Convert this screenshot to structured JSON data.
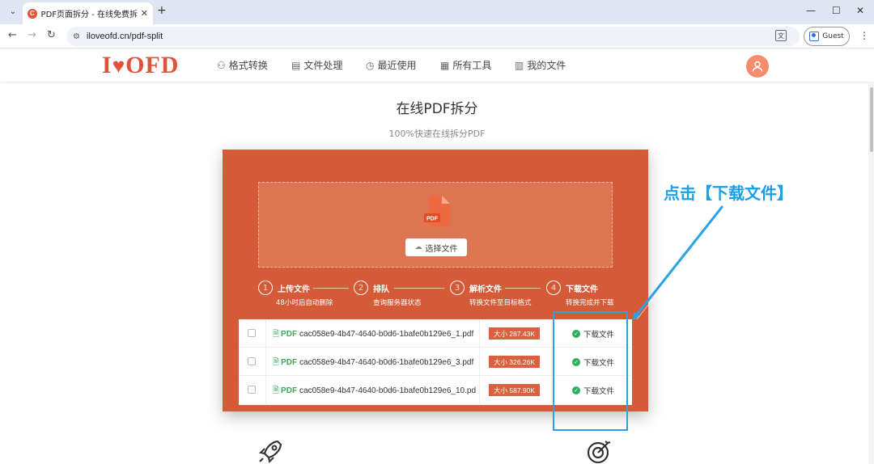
{
  "browser": {
    "tab_title": "PDF页面拆分 - 在线免费拆分PDF",
    "url": "iloveofd.cn/pdf-split",
    "profile_label": "Guest"
  },
  "site": {
    "logo": "I♥OFD",
    "nav": [
      {
        "label": "格式转换"
      },
      {
        "label": "文件处理"
      },
      {
        "label": "最近使用"
      },
      {
        "label": "所有工具"
      },
      {
        "label": "我的文件"
      }
    ]
  },
  "page": {
    "title": "在线PDF拆分",
    "subtitle": "100%快速在线拆分PDF"
  },
  "upload": {
    "file_badge": "PDF",
    "choose_label": "选择文件"
  },
  "steps": [
    {
      "num": "1",
      "title": "上传文件",
      "desc": "48小时后自动删除"
    },
    {
      "num": "2",
      "title": "排队",
      "desc": "查询服务器状态"
    },
    {
      "num": "3",
      "title": "解析文件",
      "desc": "转换文件至目标格式"
    },
    {
      "num": "4",
      "title": "下载文件",
      "desc": "转换完成并下载"
    }
  ],
  "files": [
    {
      "type": "PDF",
      "name": "cac058e9-4b47-4640-b0d6-1bafe0b129e6_1.pdf",
      "size": "大小 287.43K",
      "action": "下载文件"
    },
    {
      "type": "PDF",
      "name": "cac058e9-4b47-4640-b0d6-1bafe0b129e6_3.pdf",
      "size": "大小 326.26K",
      "action": "下载文件"
    },
    {
      "type": "PDF",
      "name": "cac058e9-4b47-4640-b0d6-1bafe0b129e6_10.pd",
      "size": "大小 587.90K",
      "action": "下载文件"
    }
  ],
  "annotation": {
    "text": "点击【下载文件】",
    "color": "#1aa0e8"
  },
  "colors": {
    "brand": "#e0523a",
    "panel": "#d45a38",
    "success": "#2fae5a"
  }
}
